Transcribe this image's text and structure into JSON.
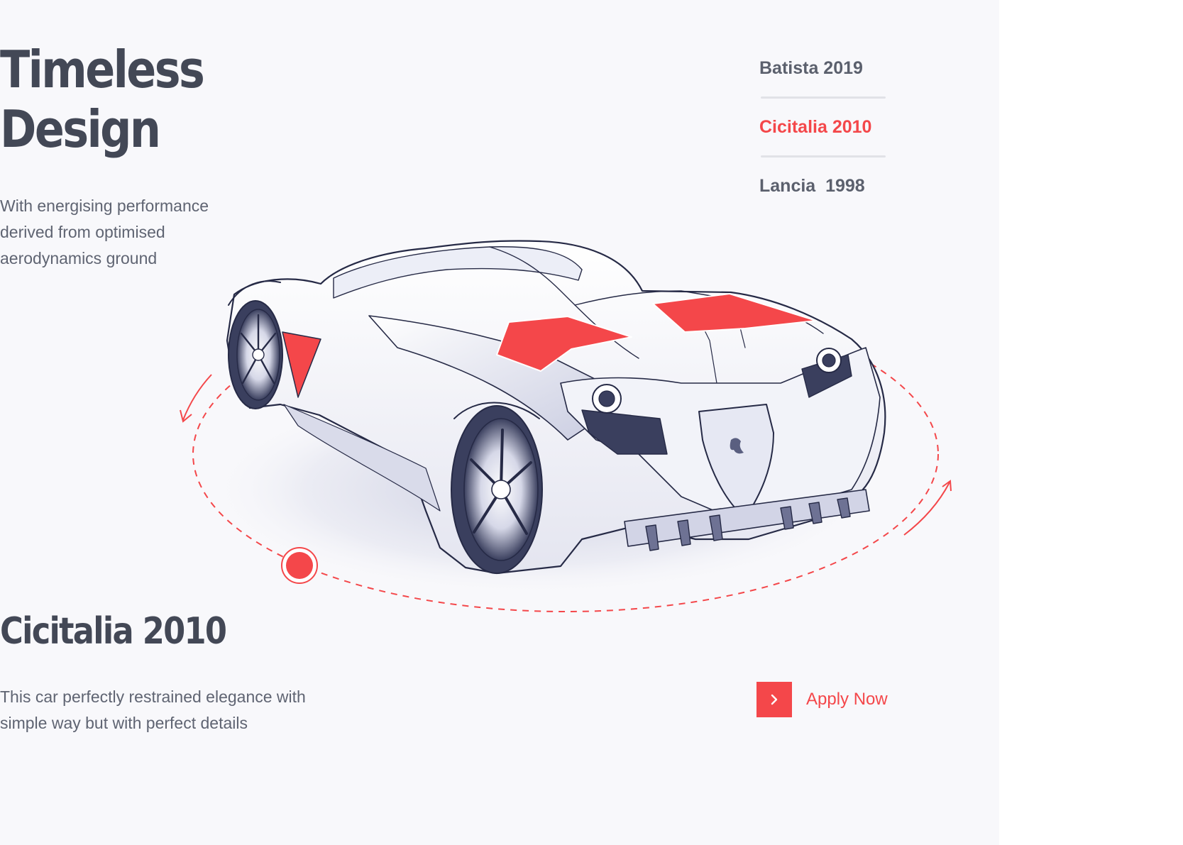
{
  "hero": {
    "title_line1": "Timeless",
    "title_line2": "Design",
    "description": "With energising performance derived from optimised aerodynamics ground"
  },
  "models": {
    "items": [
      {
        "label": "Batista 2019",
        "active": false
      },
      {
        "label": "Cicitalia 2010",
        "active": true
      },
      {
        "label": "Lancia  1998",
        "active": false
      }
    ]
  },
  "selected": {
    "name": "Cicitalia 2010",
    "description": "This car perfectly restrained elegance with simple way but with perfect details"
  },
  "cta": {
    "label": "Apply Now",
    "icon": "chevron-right-icon"
  },
  "colors": {
    "accent": "#f4474a",
    "heading": "#434856",
    "body_text": "#5f6472",
    "panel_background": "#f8f8fb"
  }
}
